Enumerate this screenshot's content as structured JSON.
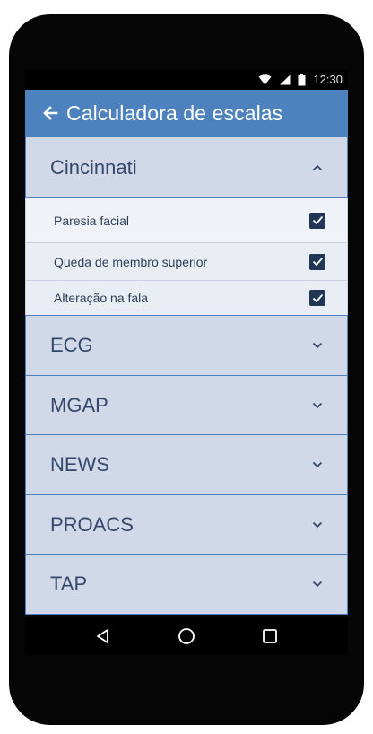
{
  "status_bar": {
    "time": "12:30",
    "icons": [
      "wifi-icon",
      "signal-icon",
      "battery-icon"
    ]
  },
  "app_bar": {
    "title": "Calculadora de escalas",
    "back_icon": "arrow-left-icon"
  },
  "sections": [
    {
      "label": "Cincinnati",
      "expanded": true,
      "items": [
        {
          "label": "Paresia facial",
          "checked": true
        },
        {
          "label": "Queda de membro superior",
          "checked": true
        },
        {
          "label": "Alteração na fala",
          "checked": true
        }
      ]
    },
    {
      "label": "ECG",
      "expanded": false
    },
    {
      "label": "MGAP",
      "expanded": false
    },
    {
      "label": "NEWS",
      "expanded": false
    },
    {
      "label": "PROACS",
      "expanded": false
    },
    {
      "label": "TAP",
      "expanded": false
    }
  ],
  "nav_bar": {
    "icons": [
      "back-triangle-icon",
      "home-circle-icon",
      "recents-square-icon"
    ]
  },
  "colors": {
    "app_bar": "#4e82bf",
    "section_bg": "#d1d9e8",
    "section_border": "#4e7fc0",
    "section_text": "#35486b",
    "item_bg": "#e9eef5",
    "checkbox": "#213655"
  }
}
